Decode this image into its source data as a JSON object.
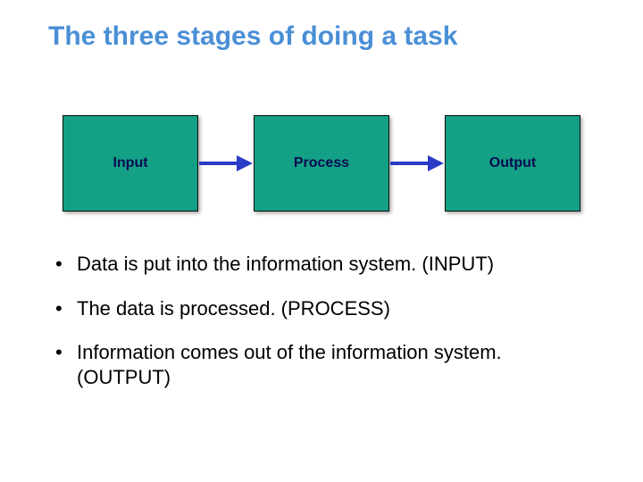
{
  "title": "The three stages of doing a task",
  "stages": {
    "input": "Input",
    "process": "Process",
    "output": "Output"
  },
  "bullets": {
    "b1": "Data is put into the information system. (INPUT)",
    "b2": "The data is processed. (PROCESS)",
    "b3": "Information comes out of the information system. (OUTPUT)"
  },
  "colors": {
    "title": "#4a8fd6",
    "box_fill": "#14a085",
    "box_text": "#0a0a50",
    "arrow": "#2a3cc7"
  }
}
